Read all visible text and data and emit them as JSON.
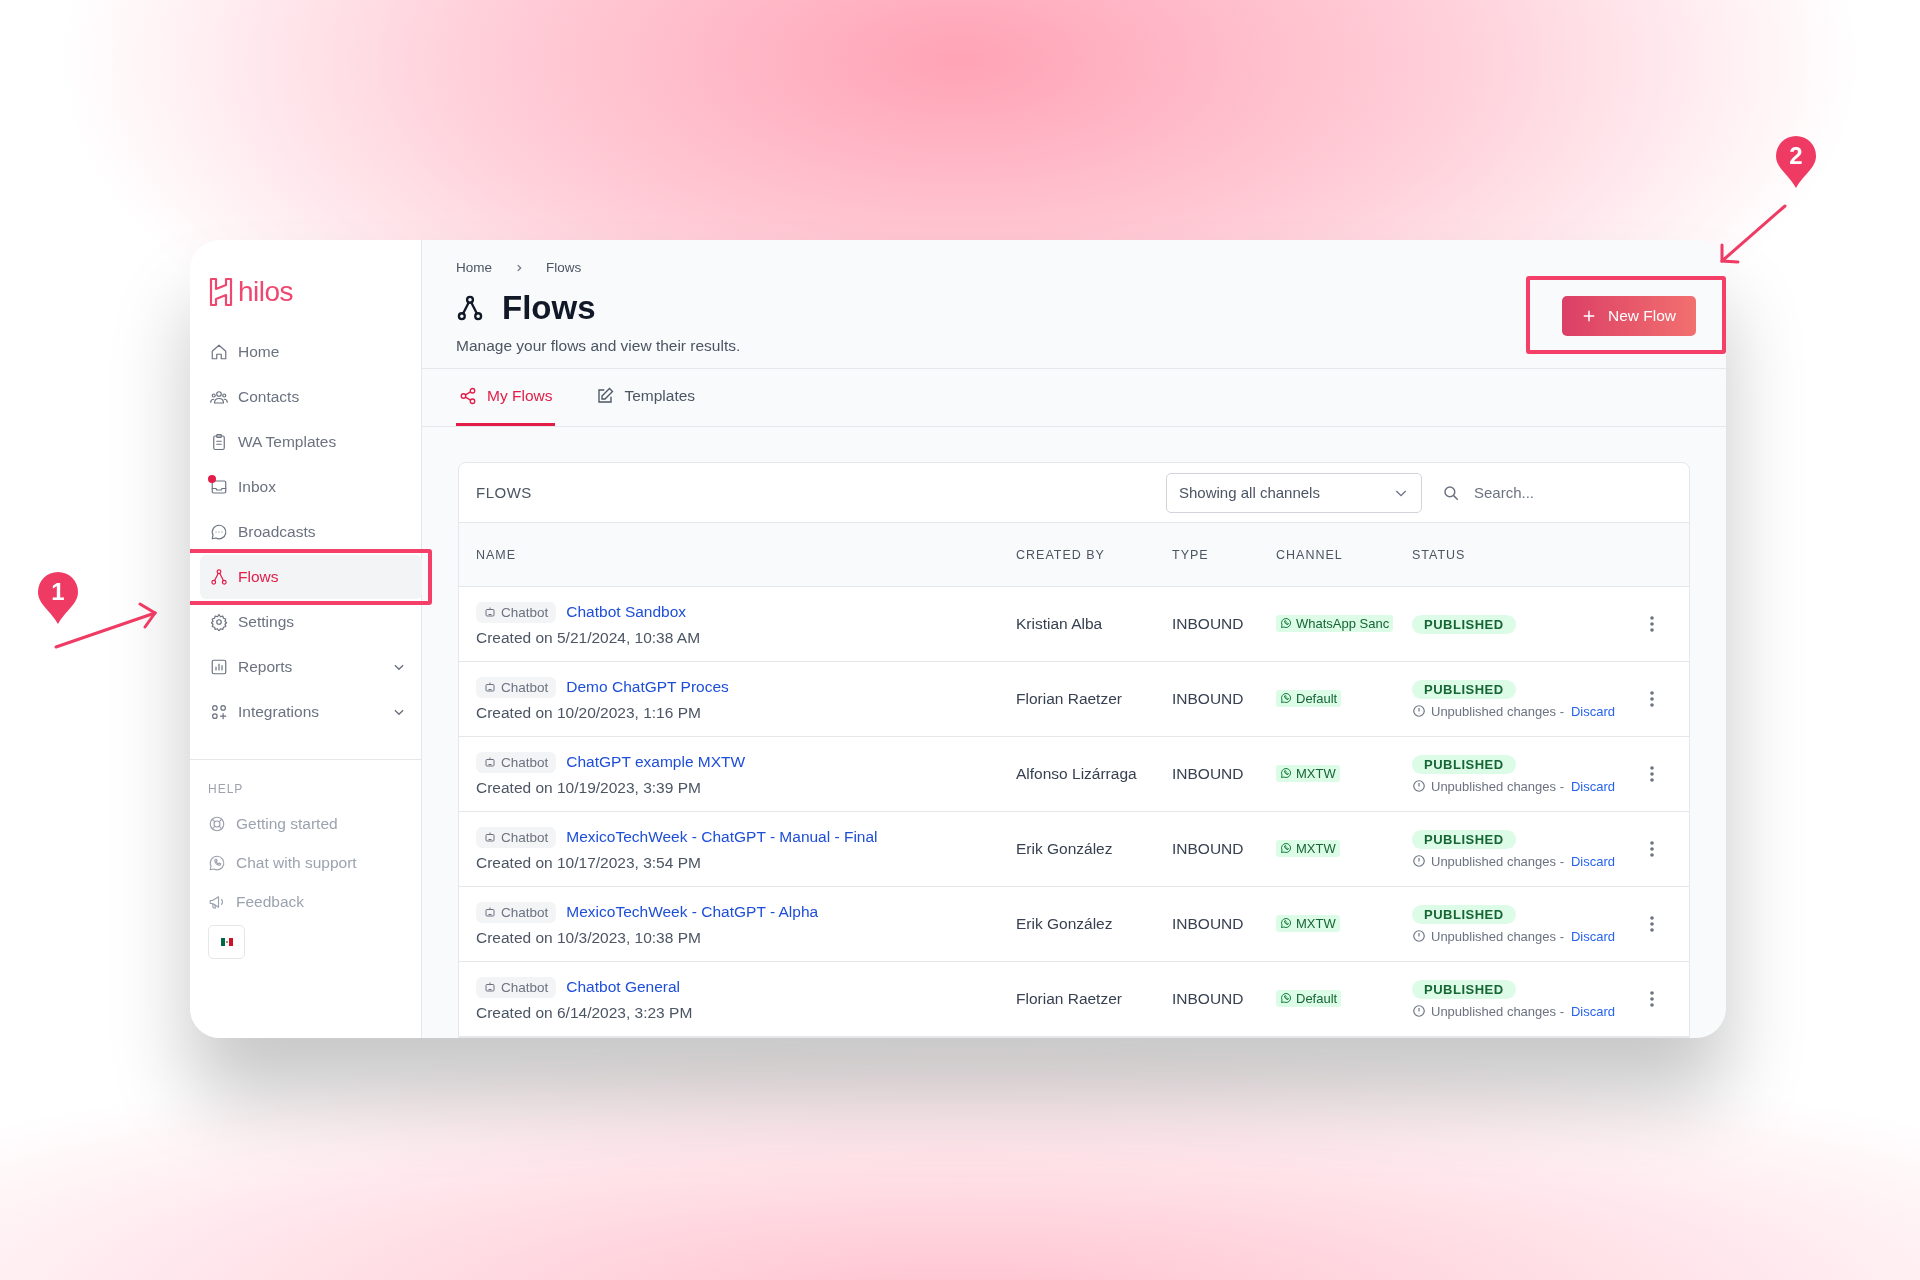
{
  "logo": {
    "text": "hilos"
  },
  "sidebar": {
    "items": [
      {
        "label": "Home",
        "selected": false,
        "unread_dot": false,
        "expandable": false,
        "highlighted": false
      },
      {
        "label": "Contacts",
        "selected": false,
        "unread_dot": false,
        "expandable": false,
        "highlighted": false
      },
      {
        "label": "WA Templates",
        "selected": false,
        "unread_dot": false,
        "expandable": false,
        "highlighted": false
      },
      {
        "label": "Inbox",
        "selected": false,
        "unread_dot": true,
        "expandable": false,
        "highlighted": false
      },
      {
        "label": "Broadcasts",
        "selected": false,
        "unread_dot": false,
        "expandable": false,
        "highlighted": false
      },
      {
        "label": "Flows",
        "selected": true,
        "unread_dot": false,
        "expandable": false,
        "highlighted": true
      },
      {
        "label": "Settings",
        "selected": false,
        "unread_dot": false,
        "expandable": false,
        "highlighted": false
      },
      {
        "label": "Reports",
        "selected": false,
        "unread_dot": false,
        "expandable": true,
        "highlighted": false
      },
      {
        "label": "Integrations",
        "selected": false,
        "unread_dot": false,
        "expandable": true,
        "highlighted": false
      }
    ],
    "help_heading": "HELP",
    "help_items": [
      {
        "label": "Getting started"
      },
      {
        "label": "Chat with support"
      },
      {
        "label": "Feedback"
      }
    ]
  },
  "breadcrumbs": [
    "Home",
    "Flows"
  ],
  "page": {
    "title": "Flows",
    "subtitle": "Manage your flows and view their results.",
    "new_button": {
      "label": "New Flow",
      "highlighted": true
    }
  },
  "tabs": [
    {
      "label": "My Flows",
      "selected": true
    },
    {
      "label": "Templates",
      "selected": false
    }
  ],
  "table": {
    "title": "FLOWS",
    "channel_filter": "Showing all channels",
    "search_placeholder": "Search...",
    "columns": [
      "NAME",
      "CREATED BY",
      "TYPE",
      "CHANNEL",
      "STATUS"
    ],
    "rows": [
      {
        "tag": "Chatbot",
        "name": "Chatbot Sandbox",
        "created": "Created on 5/21/2024, 10:38 AM",
        "created_by": "Kristian Alba",
        "type": "INBOUND",
        "channel": "WhatsApp Sanc",
        "status": "PUBLISHED"
      },
      {
        "tag": "Chatbot",
        "name": "Demo ChatGPT Proces",
        "created": "Created on 10/20/2023, 1:16 PM",
        "created_by": "Florian Raetzer",
        "type": "INBOUND",
        "channel": "Default",
        "status": "PUBLISHED",
        "note": "Unpublished changes -",
        "action": "Discard"
      },
      {
        "tag": "Chatbot",
        "name": "ChatGPT example MXTW",
        "created": "Created on 10/19/2023, 3:39 PM",
        "created_by": "Alfonso Lizárraga",
        "type": "INBOUND",
        "channel": "MXTW",
        "status": "PUBLISHED",
        "note": "Unpublished changes -",
        "action": "Discard"
      },
      {
        "tag": "Chatbot",
        "name": "MexicoTechWeek - ChatGPT - Manual - Final",
        "created": "Created on 10/17/2023, 3:54 PM",
        "created_by": "Erik González",
        "type": "INBOUND",
        "channel": "MXTW",
        "status": "PUBLISHED",
        "note": "Unpublished changes -",
        "action": "Discard"
      },
      {
        "tag": "Chatbot",
        "name": "MexicoTechWeek - ChatGPT - Alpha",
        "created": "Created on 10/3/2023, 10:38 PM",
        "created_by": "Erik González",
        "type": "INBOUND",
        "channel": "MXTW",
        "status": "PUBLISHED",
        "note": "Unpublished changes -",
        "action": "Discard"
      },
      {
        "tag": "Chatbot",
        "name": "Chatbot General",
        "created": "Created on 6/14/2023, 3:23 PM",
        "created_by": "Florian Raetzer",
        "type": "INBOUND",
        "channel": "Default",
        "status": "PUBLISHED",
        "note": "Unpublished changes -",
        "action": "Discard"
      }
    ]
  },
  "callouts": [
    "1",
    "2"
  ]
}
